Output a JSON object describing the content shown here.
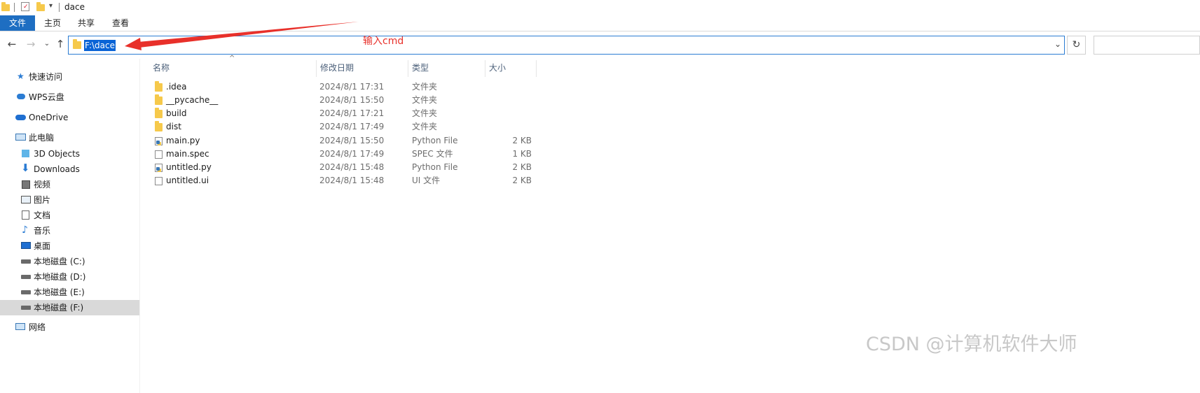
{
  "window": {
    "title": "dace"
  },
  "ribbon": {
    "tabs": [
      "文件",
      "主页",
      "共享",
      "查看"
    ]
  },
  "navigation": {
    "back_icon": "back-arrow-icon",
    "forward_icon": "forward-arrow-icon",
    "recent_icon": "chevron-down-icon",
    "up_icon": "up-arrow-icon"
  },
  "address_bar": {
    "path": "F:\\dace",
    "refresh_icon": "refresh-icon",
    "dropdown_icon": "chevron-down-icon"
  },
  "annotation": {
    "text": "输入cmd",
    "color": "#e8302a"
  },
  "sidebar": {
    "items": [
      {
        "label": "快速访问",
        "icon": "star-icon"
      },
      {
        "label": "WPS云盘",
        "icon": "cloud-icon"
      },
      {
        "label": "OneDrive",
        "icon": "onedrive-icon"
      },
      {
        "label": "此电脑",
        "icon": "computer-icon"
      },
      {
        "label": "3D Objects",
        "icon": "cube-icon"
      },
      {
        "label": "Downloads",
        "icon": "download-icon"
      },
      {
        "label": "视频",
        "icon": "video-icon"
      },
      {
        "label": "图片",
        "icon": "picture-icon"
      },
      {
        "label": "文档",
        "icon": "document-icon"
      },
      {
        "label": "音乐",
        "icon": "music-icon"
      },
      {
        "label": "桌面",
        "icon": "desktop-icon"
      },
      {
        "label": "本地磁盘 (C:)",
        "icon": "drive-icon"
      },
      {
        "label": "本地磁盘 (D:)",
        "icon": "drive-icon"
      },
      {
        "label": "本地磁盘 (E:)",
        "icon": "drive-icon"
      },
      {
        "label": "本地磁盘 (F:)",
        "icon": "drive-icon",
        "selected": true
      },
      {
        "label": "网络",
        "icon": "network-icon"
      }
    ]
  },
  "file_list": {
    "columns": [
      "名称",
      "修改日期",
      "类型",
      "大小"
    ],
    "rows": [
      {
        "name": ".idea",
        "date": "2024/8/1 17:31",
        "type": "文件夹",
        "size": "",
        "icon": "folder-icon"
      },
      {
        "name": "__pycache__",
        "date": "2024/8/1 15:50",
        "type": "文件夹",
        "size": "",
        "icon": "folder-icon"
      },
      {
        "name": "build",
        "date": "2024/8/1 17:21",
        "type": "文件夹",
        "size": "",
        "icon": "folder-icon"
      },
      {
        "name": "dist",
        "date": "2024/8/1 17:49",
        "type": "文件夹",
        "size": "",
        "icon": "folder-icon"
      },
      {
        "name": "main.py",
        "date": "2024/8/1 15:50",
        "type": "Python File",
        "size": "2 KB",
        "icon": "python-file-icon"
      },
      {
        "name": "main.spec",
        "date": "2024/8/1 17:49",
        "type": "SPEC 文件",
        "size": "1 KB",
        "icon": "file-icon"
      },
      {
        "name": "untitled.py",
        "date": "2024/8/1 15:48",
        "type": "Python File",
        "size": "2 KB",
        "icon": "python-file-icon"
      },
      {
        "name": "untitled.ui",
        "date": "2024/8/1 15:48",
        "type": "UI 文件",
        "size": "2 KB",
        "icon": "file-icon"
      }
    ]
  },
  "watermark": {
    "text": "CSDN @计算机软件大师"
  },
  "colors": {
    "accent": "#1e6ec2",
    "selection": "#0a64d6",
    "folder": "#f6c94b",
    "annotation": "#e8302a"
  }
}
